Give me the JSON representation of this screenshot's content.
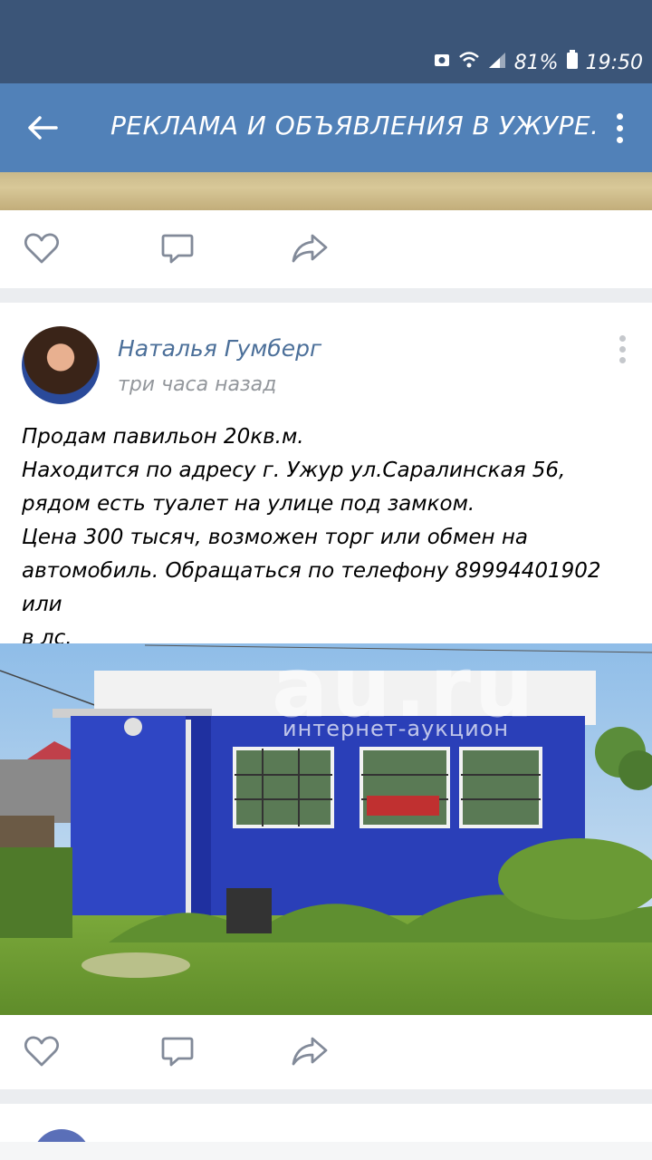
{
  "status_bar": {
    "battery": "81%",
    "time": "19:50",
    "icons": [
      "screenshot-icon",
      "wifi-icon",
      "signal-icon",
      "battery-icon"
    ]
  },
  "appbar": {
    "title": "РЕКЛАМА И ОБЪЯВЛЕНИЯ В УЖУРЕ.",
    "back_icon": "arrow-back-icon",
    "menu_icon": "more-vert-icon"
  },
  "post": {
    "author": "Наталья Гумберг",
    "time": "три часа назад",
    "text": "Продам павильон 20кв.м.\n  Находится по адресу г. Ужур ул.Саралинская 56,\nрядом есть туалет на улице под замком.\n Цена 300 тысяч, возможен торг или обмен на\nавтомобиль. Обращаться по телефону 89994401902 или\nв лс.",
    "photo": {
      "watermark_main": "au.ru",
      "watermark_sub": "интернет-аукцион"
    }
  },
  "actions": {
    "like_icon": "heart-icon",
    "comment_icon": "comment-icon",
    "share_icon": "share-icon"
  },
  "colors": {
    "status_bar": "#3b5578",
    "appbar": "#5181b8",
    "author_link": "#4b6f99",
    "background": "#ebedf0"
  }
}
